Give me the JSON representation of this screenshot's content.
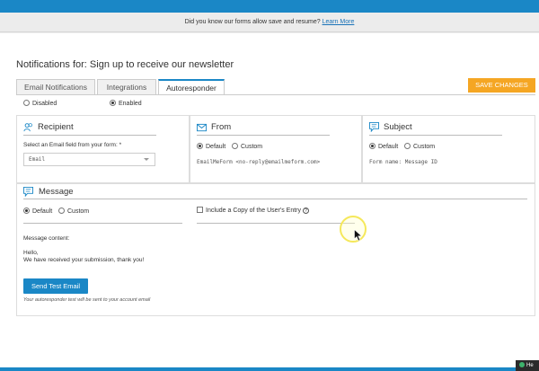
{
  "notice": {
    "text": "Did you know our forms allow save and resume?",
    "link": "Learn More"
  },
  "page": {
    "title": "Notifications for: Sign up to receive our newsletter"
  },
  "tabs": [
    {
      "label": "Email Notifications"
    },
    {
      "label": "Integrations"
    },
    {
      "label": "Autoresponder"
    }
  ],
  "toolbar": {
    "save_label": "SAVE CHANGES"
  },
  "status": {
    "disabled": "Disabled",
    "enabled": "Enabled",
    "selected": "Enabled"
  },
  "recipient": {
    "title": "Recipient",
    "field_label": "Select an Email field from your form: *",
    "selected": "Email"
  },
  "from": {
    "title": "From",
    "default": "Default",
    "custom": "Custom",
    "value": "EmailMeForm <no-reply@emailmeform.com>"
  },
  "subject": {
    "title": "Subject",
    "default": "Default",
    "custom": "Custom",
    "value": "Form name: Message ID"
  },
  "message": {
    "title": "Message",
    "default": "Default",
    "custom": "Custom",
    "copy_label": "Include a Copy of the User's Entry",
    "content_label": "Message content:",
    "line1": "Hello,",
    "line2": "We have received your submission, thank you!",
    "send_button": "Send Test Email",
    "note": "Your autoresponder test will be sent to your account email"
  },
  "corner": {
    "text": "He"
  },
  "colors": {
    "accent": "#1a87c6",
    "save": "#f5a623"
  }
}
